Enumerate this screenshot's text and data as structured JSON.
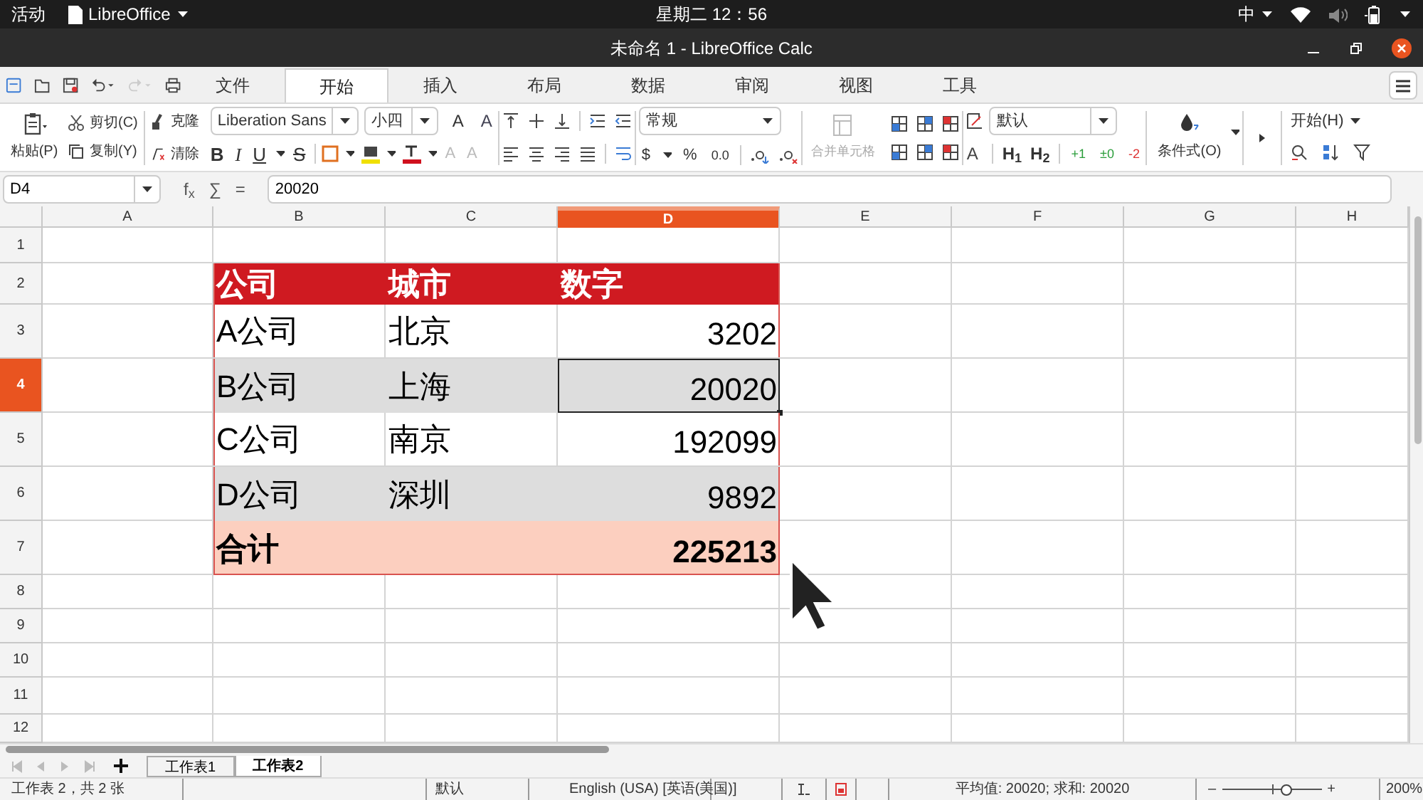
{
  "top_bar": {
    "activities": "活动",
    "app_menu": "LibreOffice",
    "clock": "星期二 12：56",
    "input_method": "中"
  },
  "window": {
    "title": "未命名 1 - LibreOffice Calc"
  },
  "menu_tabs": [
    {
      "label": "文件",
      "selected": false
    },
    {
      "label": "开始",
      "selected": true
    },
    {
      "label": "插入",
      "selected": false
    },
    {
      "label": "布局",
      "selected": false
    },
    {
      "label": "数据",
      "selected": false
    },
    {
      "label": "审阅",
      "selected": false
    },
    {
      "label": "视图",
      "selected": false
    },
    {
      "label": "工具",
      "selected": false
    }
  ],
  "toolbar": {
    "paste": "粘贴(P)",
    "cut": "剪切(C)",
    "copy": "复制(Y)",
    "clone": "克隆",
    "clear": "清除",
    "font_name": "Liberation Sans",
    "font_size": "小四",
    "font_size_buttons": [
      "A",
      "A"
    ],
    "format_buttons": [
      "B",
      "I",
      "U",
      "S"
    ],
    "script_buttons": [
      "A",
      "A"
    ],
    "number_format": "常规",
    "number_buttons": [
      "$",
      "%",
      "0.0"
    ],
    "merge": {
      "label": "合并单元格",
      "disabled": true
    },
    "cell_style": "默认",
    "style_buttons": [
      "A",
      "H$_{1}$",
      "H$_{2}$"
    ],
    "increments": [
      "+1",
      "±0",
      "-2"
    ],
    "conditional": "条件式(O)",
    "style_menu": "开始(H)"
  },
  "formula_bar": {
    "cell_ref": "D4",
    "function_buttons": [
      "f$_{x}$",
      "∑",
      "="
    ],
    "formula": "20020"
  },
  "columns": [
    {
      "label": "A",
      "selected": false
    },
    {
      "label": "B",
      "selected": false
    },
    {
      "label": "C",
      "selected": false
    },
    {
      "label": "D",
      "selected": true
    },
    {
      "label": "E",
      "selected": false
    },
    {
      "label": "F",
      "selected": false
    },
    {
      "label": "G",
      "selected": false
    },
    {
      "label": "H",
      "selected": false
    }
  ],
  "rows": [
    {
      "number": "1",
      "selected": false
    },
    {
      "number": "2",
      "selected": false,
      "kind": "header",
      "cells": [
        {
          "text": "公司",
          "selected": false
        },
        {
          "text": "城市",
          "selected": false
        },
        {
          "text": "数字",
          "selected": false
        }
      ]
    },
    {
      "number": "3",
      "selected": false,
      "kind": "plain",
      "cells": [
        {
          "text": "A公司",
          "selected": false
        },
        {
          "text": "北京",
          "selected": false
        },
        {
          "text": "3202",
          "kind": "number",
          "selected": false
        }
      ]
    },
    {
      "number": "4",
      "selected": true,
      "kind": "band",
      "cells": [
        {
          "text": "B公司",
          "selected": false
        },
        {
          "text": "上海",
          "selected": false
        },
        {
          "text": "20020",
          "kind": "number",
          "selected": true
        }
      ]
    },
    {
      "number": "5",
      "selected": false,
      "kind": "plain",
      "cells": [
        {
          "text": "C公司",
          "selected": false
        },
        {
          "text": "南京",
          "selected": false
        },
        {
          "text": "192099",
          "kind": "number",
          "selected": false
        }
      ]
    },
    {
      "number": "6",
      "selected": false,
      "kind": "band",
      "cells": [
        {
          "text": "D公司",
          "selected": false
        },
        {
          "text": "深圳",
          "selected": false
        },
        {
          "text": "9892",
          "kind": "number",
          "selected": false
        }
      ]
    },
    {
      "number": "7",
      "selected": false,
      "kind": "total",
      "cells": [
        {
          "text": "合计",
          "selected": false
        },
        {
          "text": "225213",
          "kind": "number",
          "selected": false
        }
      ]
    },
    {
      "number": "8",
      "selected": false
    },
    {
      "number": "9",
      "selected": false
    },
    {
      "number": "10",
      "selected": false
    },
    {
      "number": "11",
      "selected": false
    },
    {
      "number": "12",
      "selected": false
    }
  ],
  "sheet_tabs": [
    {
      "label": "工作表1",
      "selected": false
    },
    {
      "label": "工作表2",
      "selected": true
    }
  ],
  "status_bar": {
    "sheet_info": "工作表 2，共 2 张",
    "page_style": "默认",
    "language": "English (USA) [英语(美国)]",
    "selection_stats": "平均值: 20020; 求和: 20020",
    "zoom_out": "–",
    "zoom_in": "+",
    "zoom": {
      "level": 0.65,
      "reading": "200%"
    }
  }
}
